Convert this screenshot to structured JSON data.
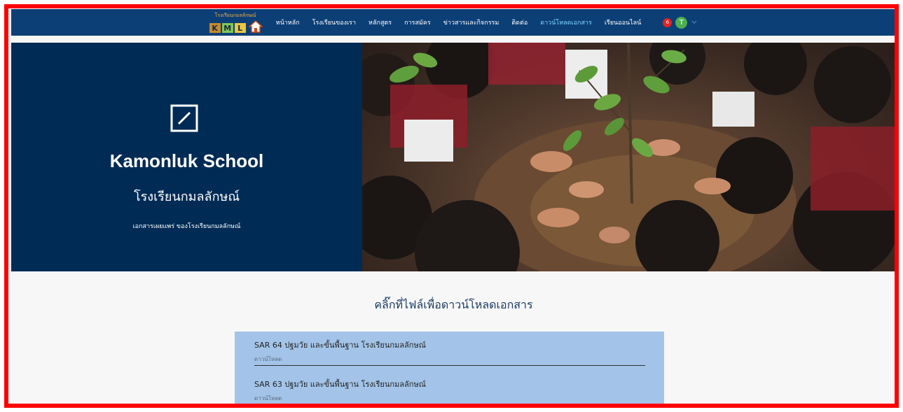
{
  "nav": {
    "logo_text": "โรงเรียนกมลลักษณ์",
    "logo_letters": [
      "K",
      "M",
      "L"
    ],
    "items": [
      {
        "label": "หน้าหลัก",
        "active": false
      },
      {
        "label": "โรงเรียนของเรา",
        "active": false
      },
      {
        "label": "หลักสูตร",
        "active": false
      },
      {
        "label": "การสมัคร",
        "active": false
      },
      {
        "label": "ข่าวสารและกิจกรรม",
        "active": false
      },
      {
        "label": "ติดต่อ",
        "active": false
      },
      {
        "label": "ดาวน์โหลดเอกสาร",
        "active": true
      },
      {
        "label": "เรียนออนไลน์",
        "active": false
      }
    ],
    "notification_count": "6",
    "avatar_initial": "T"
  },
  "hero": {
    "title": "Kamonluk School",
    "subtitle": "โรงเรียนกมลลักษณ์",
    "description": "เอกสารเผยแพร่ ของโรงเรียนกมลลักษณ์"
  },
  "downloads": {
    "heading": "คลิ๊กที่ไฟล์เพื่อดาวน์โหลดเอกสาร",
    "items": [
      {
        "title": "SAR 64 ปฐมวัย และขั้นพื้นฐาน โรงเรียนกมลลักษณ์",
        "link": "ดาวน์โหลด"
      },
      {
        "title": "SAR 63 ปฐมวัย และขั้นพื้นฐาน โรงเรียนกมลลักษณ์",
        "link": "ดาวน์โหลด"
      }
    ]
  },
  "colors": {
    "nav_bg": "#0d3f77",
    "hero_bg": "#002b55",
    "panel_bg": "#a3c4e8",
    "active_nav": "#7fd6ff",
    "frame": "#ff0000"
  }
}
